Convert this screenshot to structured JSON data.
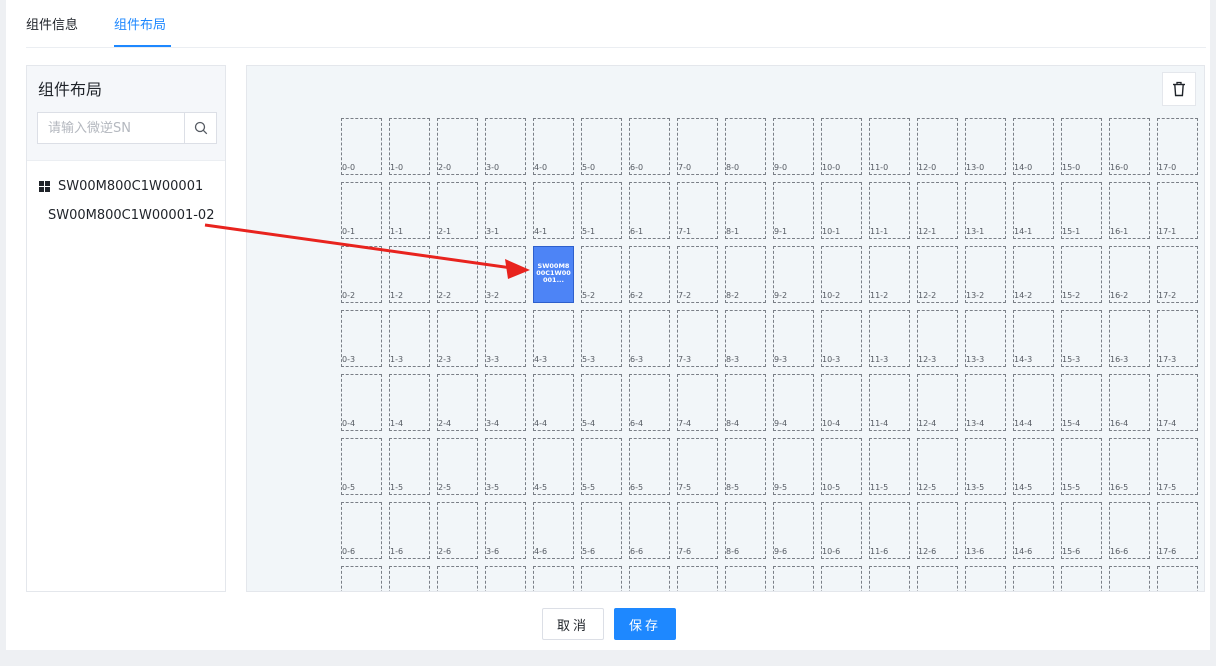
{
  "tabs": [
    {
      "label": "组件信息",
      "active": false
    },
    {
      "label": "组件布局",
      "active": true
    }
  ],
  "sidebar": {
    "title": "组件布局",
    "search": {
      "placeholder": "请输入微逆SN",
      "value": ""
    },
    "tree": {
      "root_label": "SW00M800C1W00001",
      "children": [
        {
          "label": "SW00M800C1W00001-02"
        }
      ]
    }
  },
  "layout": {
    "columns": 18,
    "rows": 8,
    "placed_module": {
      "label": "SW00M800C1W00001...",
      "col": 4,
      "row": 2
    }
  },
  "footer": {
    "cancel_label": "取消",
    "save_label": "保存"
  },
  "colors": {
    "accent": "#1e88ff",
    "module_fill": "#4d84f6",
    "arrow": "#e8231e"
  }
}
